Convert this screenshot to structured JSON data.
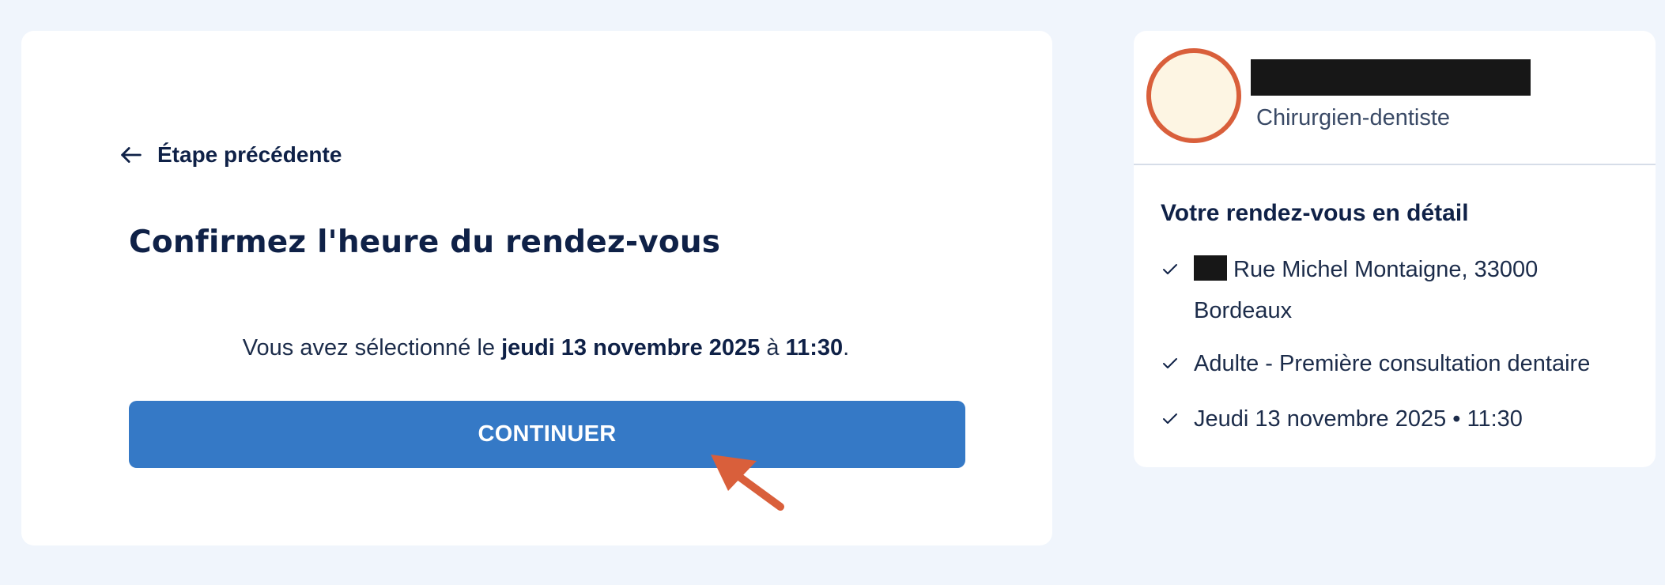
{
  "main": {
    "back_label": "Étape précédente",
    "title": "Confirmez l'heure du rendez-vous",
    "selection": {
      "prefix": "Vous avez sélectionné le",
      "date": "jeudi 13 novembre 2025",
      "connector": "à",
      "time": "11:30",
      "suffix": "."
    },
    "continue_label": "CONTINUER"
  },
  "sidebar": {
    "specialty": "Chirurgien-dentiste",
    "details_title": "Votre rendez-vous en détail",
    "details": [
      {
        "icon": "check-icon",
        "text": "Rue Michel Montaigne, 33000 Bordeaux"
      },
      {
        "icon": "check-icon",
        "text": "Adulte - Première consultation dentaire"
      },
      {
        "icon": "check-icon",
        "text": "Jeudi 13 novembre 2025 • 11:30"
      }
    ]
  },
  "colors": {
    "background": "#f0f5fc",
    "primary_button": "#3579c6",
    "text_dark": "#0f2147",
    "avatar_ring": "#d95f3b",
    "avatar_fill": "#fdf5e3",
    "annotation_arrow": "#d95f3b"
  }
}
